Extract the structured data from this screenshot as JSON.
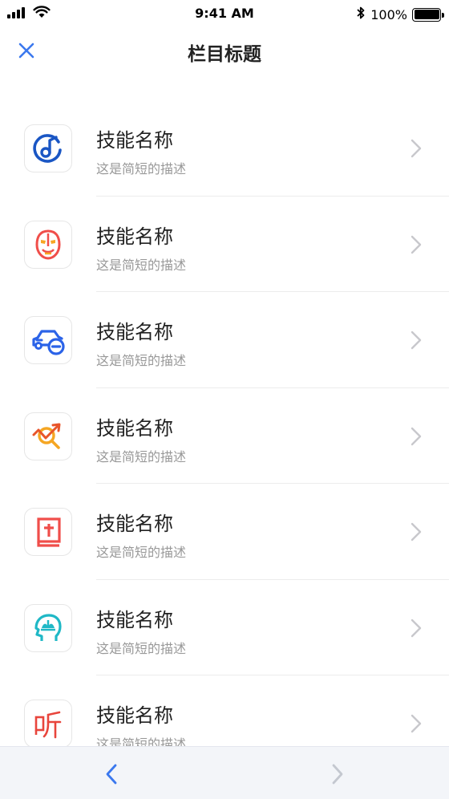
{
  "status_bar": {
    "time": "9:41 AM",
    "battery": "100%",
    "icons": [
      "signal-icon",
      "wifi-icon",
      "bluetooth-icon",
      "battery-icon"
    ]
  },
  "nav": {
    "title": "栏目标题",
    "close_icon": "close-icon"
  },
  "colors": {
    "accent": "#3b78ee",
    "text_primary": "#222222",
    "text_secondary": "#999999",
    "divider": "#ececec",
    "toolbar_bg": "#f3f5f9"
  },
  "list": {
    "items": [
      {
        "title": "技能名称",
        "description": "这是简短的描述",
        "icon": "music-note-c-icon"
      },
      {
        "title": "技能名称",
        "description": "这是简短的描述",
        "icon": "opera-mask-icon"
      },
      {
        "title": "技能名称",
        "description": "这是简短的描述",
        "icon": "car-minus-icon"
      },
      {
        "title": "技能名称",
        "description": "这是简短的描述",
        "icon": "trend-magnifier-icon"
      },
      {
        "title": "技能名称",
        "description": "这是简短的描述",
        "icon": "bible-book-icon"
      },
      {
        "title": "技能名称",
        "description": "这是简短的描述",
        "icon": "head-lotus-icon"
      },
      {
        "title": "技能名称",
        "description": "这是简短的描述",
        "icon": "ting-listen-icon"
      }
    ]
  },
  "toolbar": {
    "back_icon": "chevron-left-icon",
    "forward_icon": "chevron-right-icon"
  }
}
